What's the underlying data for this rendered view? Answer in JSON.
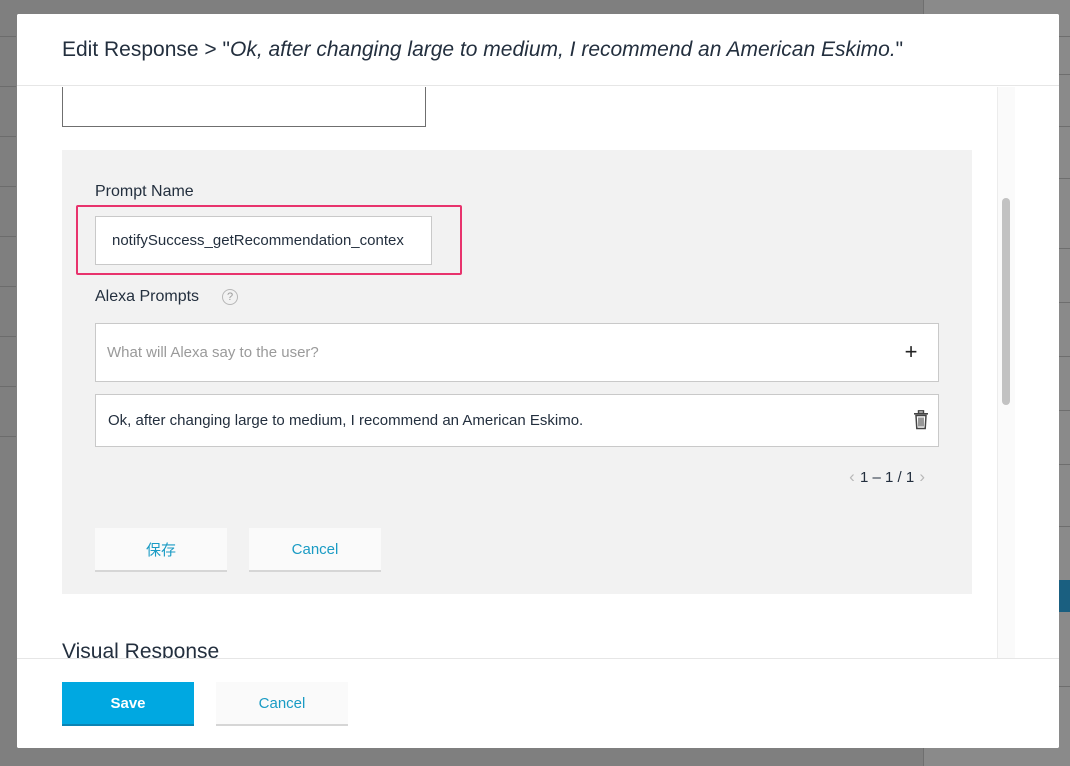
{
  "modal": {
    "title_prefix": "Edit Response > \"",
    "title_quote": "Ok, after changing large to medium, I recommend an American Eskimo.",
    "title_suffix": "\""
  },
  "prompt_editor": {
    "name_label": "Prompt Name",
    "name_value": "notifySuccess_getRecommendation_contex",
    "prompts_label": "Alexa Prompts",
    "help_icon_glyph": "?",
    "say_placeholder": "What will Alexa say to the user?",
    "add_glyph": "+",
    "items": [
      {
        "text": "Ok, after changing large to medium, I recommend an American Eskimo."
      }
    ],
    "pagination": "1 – 1 / 1",
    "save_label": "保存",
    "cancel_label": "Cancel"
  },
  "visual_response": {
    "title": "Visual Response"
  },
  "footer": {
    "save_label": "Save",
    "cancel_label": "Cancel"
  },
  "colors": {
    "primary": "#00a8e1",
    "link": "#1a9bc4",
    "highlight": "#e8336d",
    "card_bg": "#f2f2f2"
  },
  "icons": [
    "help-icon",
    "plus-icon",
    "trash-icon",
    "chevron-left-icon",
    "chevron-right-icon"
  ]
}
